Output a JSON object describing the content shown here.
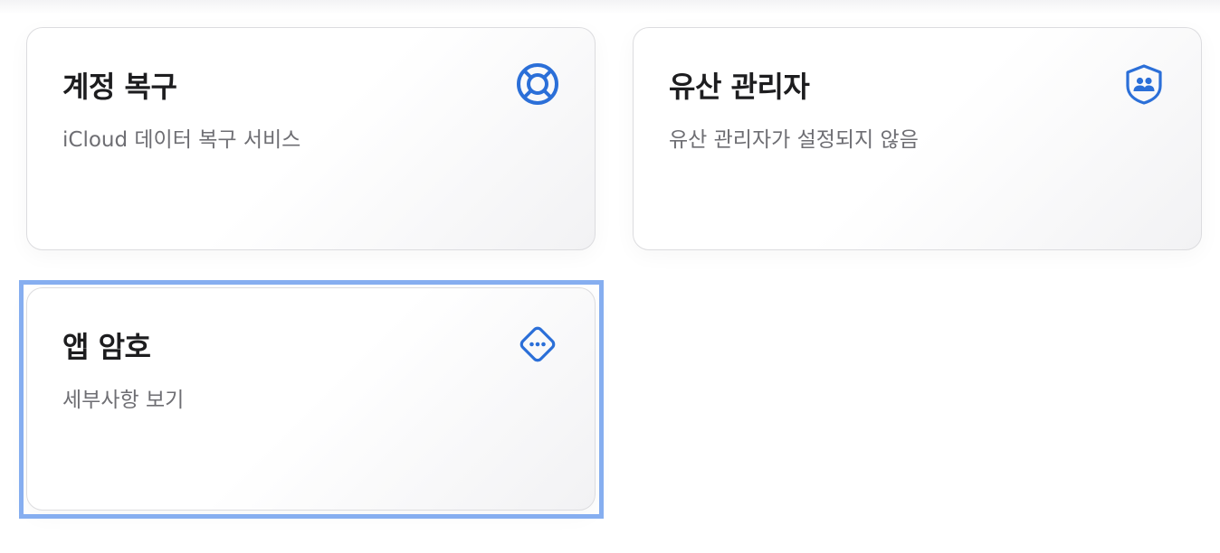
{
  "cards": [
    {
      "title": "계정 복구",
      "subtitle": "iCloud 데이터 복구 서비스",
      "icon": "lifebuoy-icon"
    },
    {
      "title": "유산 관리자",
      "subtitle": "유산 관리자가 설정되지 않음",
      "icon": "legacy-contact-shield-icon"
    },
    {
      "title": "앱 암호",
      "subtitle": "세부사항 보기",
      "icon": "diamond-ellipsis-icon"
    }
  ],
  "colors": {
    "accent": "#2b6fd8",
    "focus_ring": "#86aef0",
    "title": "#1d1d1f",
    "subtitle": "#6e6e73",
    "card_border": "#dcdcdf"
  }
}
